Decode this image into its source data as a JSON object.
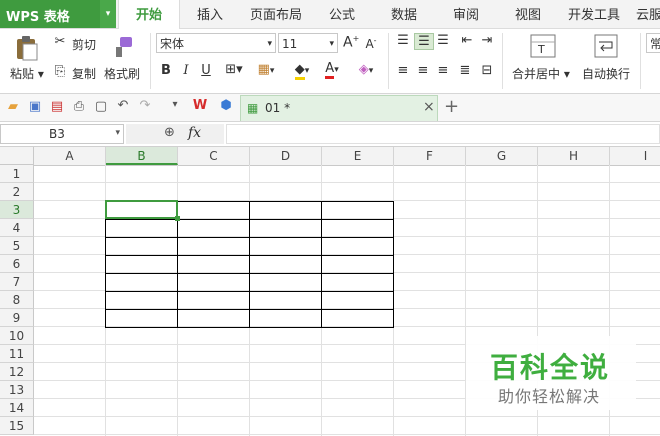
{
  "app": {
    "label": "WPS 表格",
    "menu_arrow": "▾"
  },
  "tabs": [
    "开始",
    "插入",
    "页面布局",
    "公式",
    "数据",
    "审阅",
    "视图",
    "开发工具",
    "云服"
  ],
  "active_tab": 0,
  "ribbon": {
    "paste": "粘贴",
    "cut": "剪切",
    "copy": "复制",
    "format_painter": "格式刷",
    "font_name": "宋体",
    "font_size": "11",
    "merge_center": "合并居中",
    "wrap_text": "自动换行",
    "general": "常"
  },
  "doc_tab": {
    "name": "01 *",
    "close": "×",
    "add": "+"
  },
  "formula_bar": {
    "cell_ref": "B3",
    "fx": "fx"
  },
  "columns": [
    "A",
    "B",
    "C",
    "D",
    "E",
    "F",
    "G",
    "H",
    "I"
  ],
  "rows": [
    "1",
    "2",
    "3",
    "4",
    "5",
    "6",
    "7",
    "8",
    "9",
    "10",
    "11",
    "12",
    "13",
    "14",
    "15"
  ],
  "selected": {
    "column": "B",
    "row": "3"
  },
  "watermark": {
    "title": "百科全说",
    "subtitle": "助你轻松解决"
  },
  "colors": {
    "accent": "#3f9b3f",
    "watermark_green": "#3fae3f"
  }
}
